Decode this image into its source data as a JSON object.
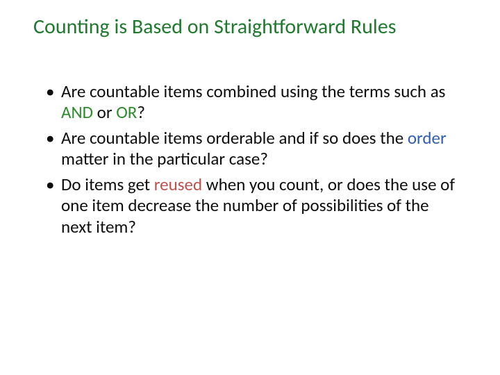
{
  "title": "Counting is Based on Straightforward Rules",
  "bullets": {
    "b0": {
      "t0": "Are countable items combined using the terms such as ",
      "and": "AND",
      "t1": " or ",
      "or": "OR",
      "t2": "?"
    },
    "b1": {
      "t0": "Are countable items orderable and if so does the ",
      "order": "order",
      "t1": " matter in the particular case?"
    },
    "b2": {
      "t0": "Do items get ",
      "reused": "reused",
      "t1": " when you count, or does the use of one item decrease the number of possibilities of the next item?"
    }
  }
}
